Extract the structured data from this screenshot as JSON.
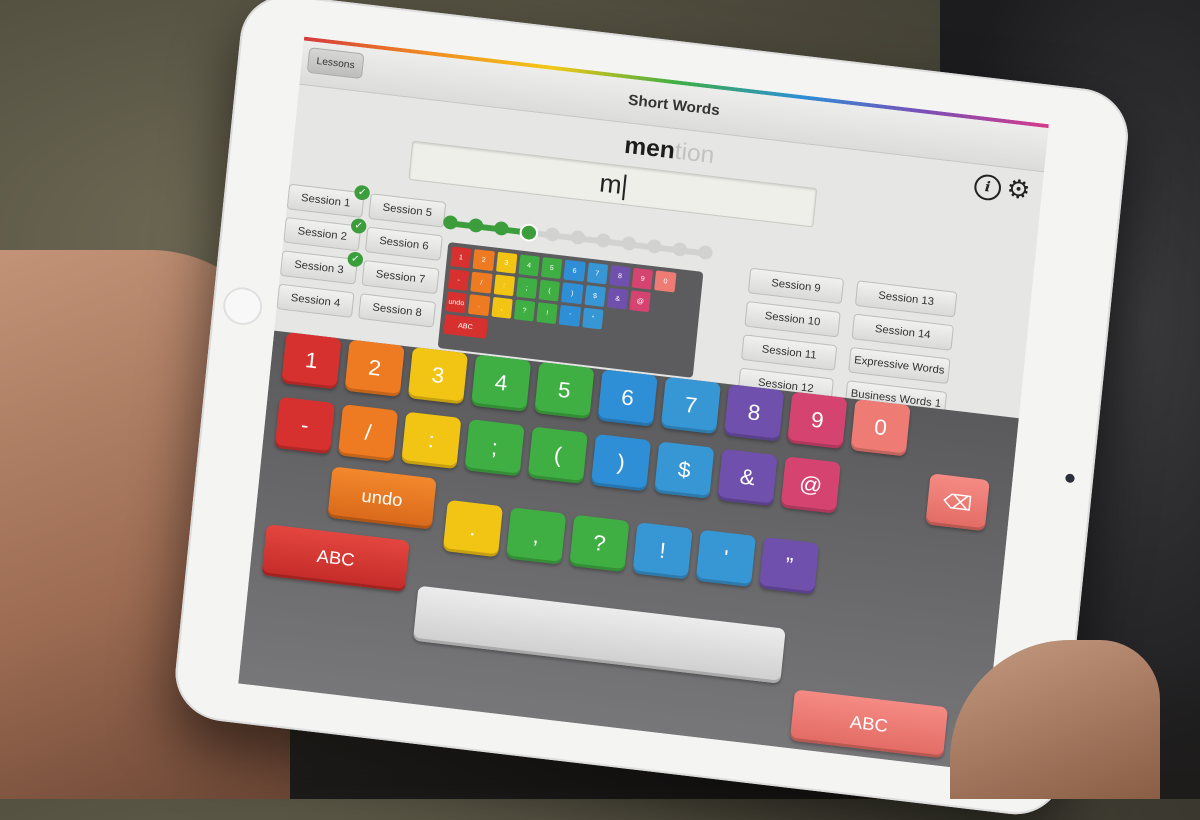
{
  "nav": {
    "back_label": "Lessons",
    "title": "Short Words"
  },
  "word": {
    "typed": "men",
    "remaining": "tion",
    "input_value": "m"
  },
  "sessions": {
    "left": [
      {
        "label": "Session 1",
        "done": true
      },
      {
        "label": "Session 2",
        "done": true
      },
      {
        "label": "Session 3",
        "done": true
      },
      {
        "label": "Session 4",
        "done": false
      },
      {
        "label": "Session 5",
        "done": false
      },
      {
        "label": "Session 6",
        "done": false
      },
      {
        "label": "Session 7",
        "done": false
      },
      {
        "label": "Session 8",
        "done": false
      }
    ],
    "right": [
      {
        "label": "Session 9"
      },
      {
        "label": "Session 10"
      },
      {
        "label": "Session 11"
      },
      {
        "label": "Session 12"
      },
      {
        "label": "Session 13"
      },
      {
        "label": "Session 14"
      },
      {
        "label": "Expressive Words"
      },
      {
        "label": "Business Words 1"
      }
    ]
  },
  "progress": {
    "completed_steps": 3,
    "current_step": 4,
    "total_steps": 11
  },
  "keyboard": {
    "row1": [
      {
        "label": "1",
        "color": "#d6312e"
      },
      {
        "label": "2",
        "color": "#ee7a22"
      },
      {
        "label": "3",
        "color": "#f2c414"
      },
      {
        "label": "4",
        "color": "#3fae43"
      },
      {
        "label": "5",
        "color": "#3fae43"
      },
      {
        "label": "6",
        "color": "#2f8fd6"
      },
      {
        "label": "7",
        "color": "#3796d4"
      },
      {
        "label": "8",
        "color": "#7050ad"
      },
      {
        "label": "9",
        "color": "#d54471"
      },
      {
        "label": "0",
        "color": "#ee7b74"
      }
    ],
    "row2": [
      {
        "label": "-",
        "color": "#d6312e"
      },
      {
        "label": "/",
        "color": "#ee7a22"
      },
      {
        "label": ":",
        "color": "#f2c414"
      },
      {
        "label": ";",
        "color": "#3fae43"
      },
      {
        "label": "(",
        "color": "#3fae43"
      },
      {
        "label": ")",
        "color": "#2f8fd6"
      },
      {
        "label": "$",
        "color": "#3796d4"
      },
      {
        "label": "&",
        "color": "#7050ad"
      },
      {
        "label": "@",
        "color": "#d54471"
      }
    ],
    "row3": [
      {
        "label": ".",
        "color": "#f2c414"
      },
      {
        "label": ",",
        "color": "#3fae43"
      },
      {
        "label": "?",
        "color": "#3fae43"
      },
      {
        "label": "!",
        "color": "#3796d4"
      },
      {
        "label": "'",
        "color": "#3796d4"
      },
      {
        "label": "”",
        "color": "#7050ad"
      }
    ],
    "undo_label": "undo",
    "abc_left_label": "ABC",
    "abc_right_label": "ABC",
    "delete_icon": "backspace-icon"
  },
  "mini_keyboard": {
    "keys": [
      "1",
      "2",
      "3",
      "4",
      "5",
      "6",
      "7",
      "8",
      "9",
      "0",
      "",
      "-",
      "/",
      ":",
      ";",
      "(",
      ")",
      "$",
      "&",
      "@",
      "",
      "",
      "undo",
      ".",
      ",",
      "?",
      "!",
      "'",
      "”",
      "",
      "",
      "",
      ""
    ],
    "undo_label": "undo",
    "abc_label": "ABC"
  },
  "icons": {
    "info": "info-icon",
    "settings": "gear-icon",
    "check": "check-icon"
  }
}
